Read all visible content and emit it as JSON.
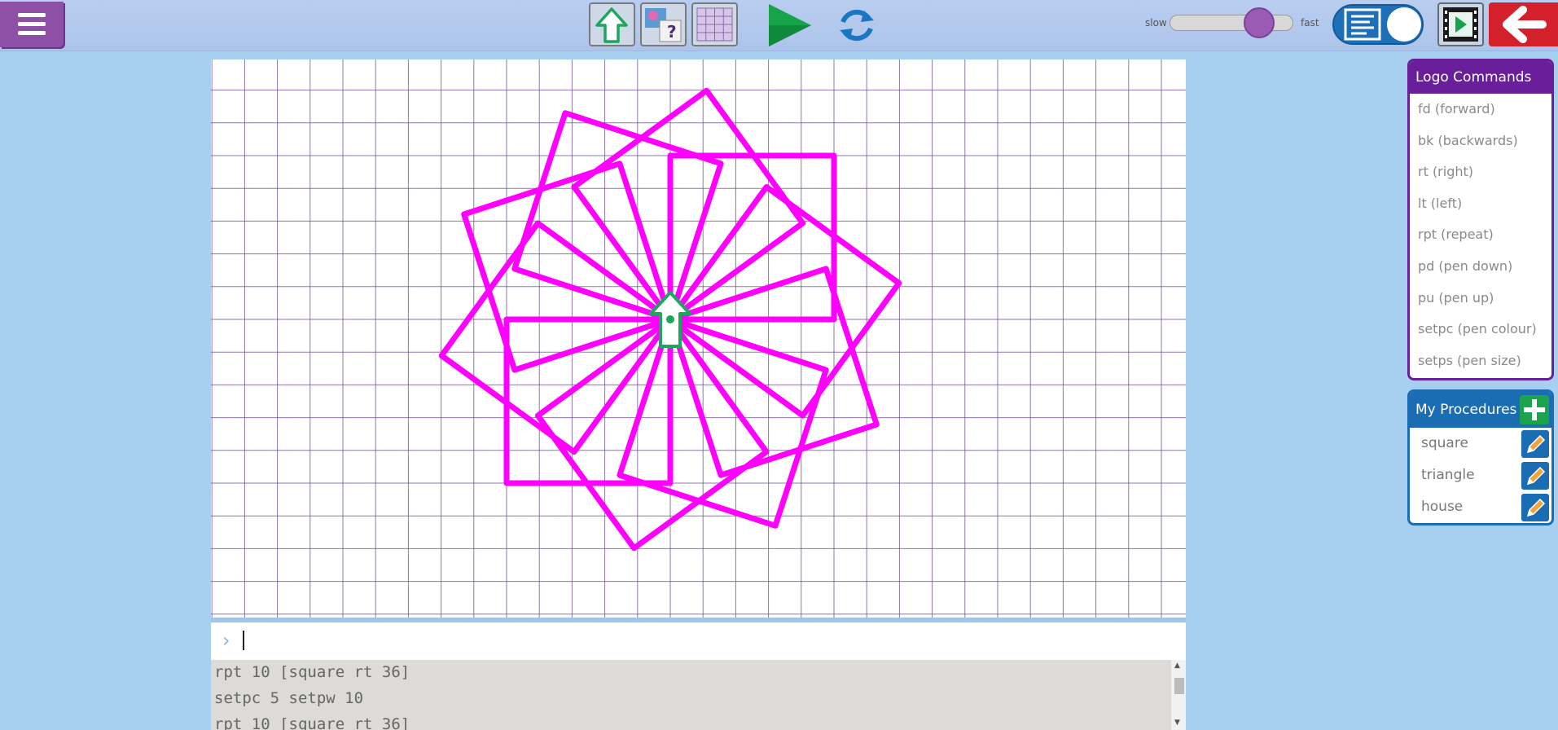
{
  "toolbar": {
    "menu_icon": "hamburger-icon",
    "turtle_icon": "turtle-arrow-icon",
    "background_icon": "background-image-icon",
    "grid_icon": "grid-icon",
    "run_icon": "play-icon",
    "reset_icon": "refresh-icon",
    "speed_slow_label": "slow",
    "speed_fast_label": "fast",
    "speed_level": 0.73,
    "view_toggle_icon": "text-view-toggle-icon",
    "film_icon": "film-icon",
    "exit_icon": "back-arrow-icon"
  },
  "canvas": {
    "pen_colour": "#ff00ff",
    "grid_colour": "#6a4a8a"
  },
  "command_input": {
    "prompt_symbol": "›",
    "value": ""
  },
  "history": {
    "lines": [
      "rpt 10 [square rt 36]",
      "setpc 5 setpw 10",
      "rpt 10 [square rt 36]"
    ]
  },
  "logo_commands": {
    "title": "Logo Commands",
    "items": [
      "fd (forward)",
      "bk (backwards)",
      "rt (right)",
      "lt (left)",
      "rpt (repeat)",
      "pd (pen down)",
      "pu (pen up)",
      "setpc (pen colour)",
      "setps (pen size)"
    ]
  },
  "procedures": {
    "title": "My Procedures",
    "add_icon": "plus-icon",
    "items": [
      "square",
      "triangle",
      "house"
    ],
    "edit_icon": "pencil-icon"
  },
  "colors": {
    "accent_purple": "#6a1f9a",
    "accent_blue": "#1a6cb3",
    "exit_red": "#d4202a"
  }
}
